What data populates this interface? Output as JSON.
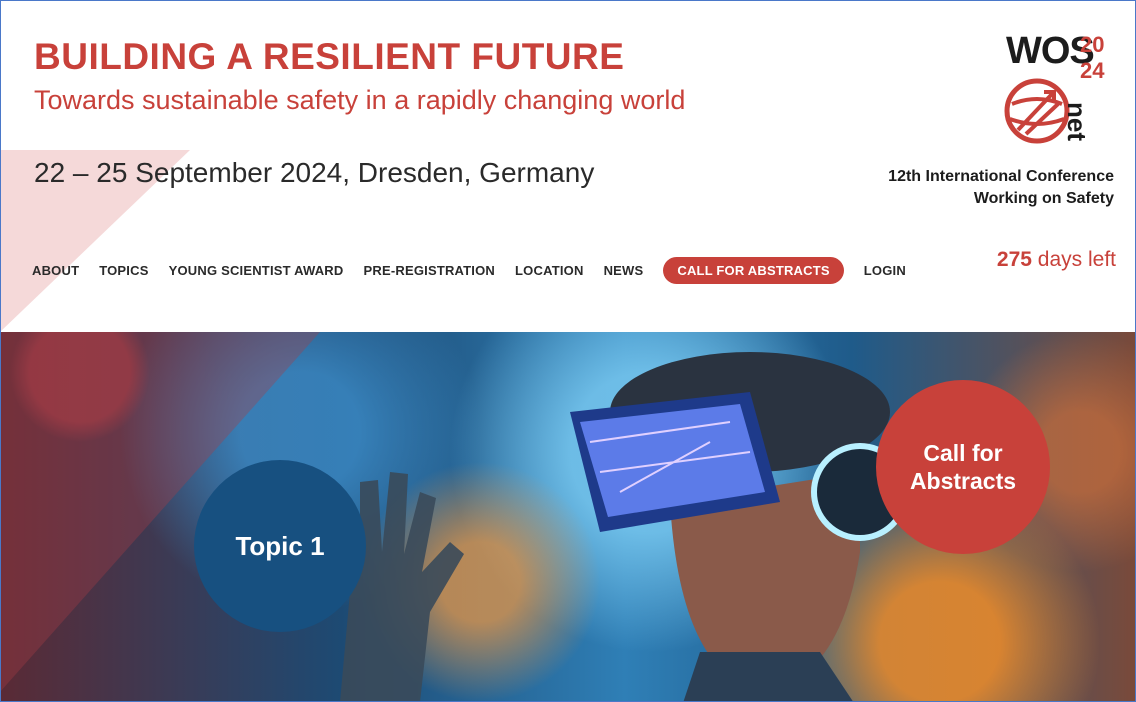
{
  "header": {
    "title": "BUILDING A RESILIENT FUTURE",
    "subtitle": "Towards sustainable safety in a rapidly changing world",
    "dateline": "22 – 25 September 2024, Dresden, Germany",
    "conference_line1": "12th International Conference",
    "conference_line2": "Working on Safety"
  },
  "logo": {
    "wos": "WOS",
    "year_top": "20",
    "year_bottom": "24",
    "net": "net"
  },
  "nav": {
    "items": [
      "ABOUT",
      "TOPICS",
      "YOUNG SCIENTIST AWARD",
      "PRE-REGISTRATION",
      "LOCATION",
      "NEWS",
      "CALL FOR ABSTRACTS",
      "LOGIN"
    ]
  },
  "countdown": {
    "number": "275",
    "label": " days left"
  },
  "hero": {
    "topic_label": "Topic 1",
    "cfa_line1": "Call for",
    "cfa_line2": "Abstracts"
  },
  "colors": {
    "accent": "#c8413a",
    "blue": "#175080"
  }
}
